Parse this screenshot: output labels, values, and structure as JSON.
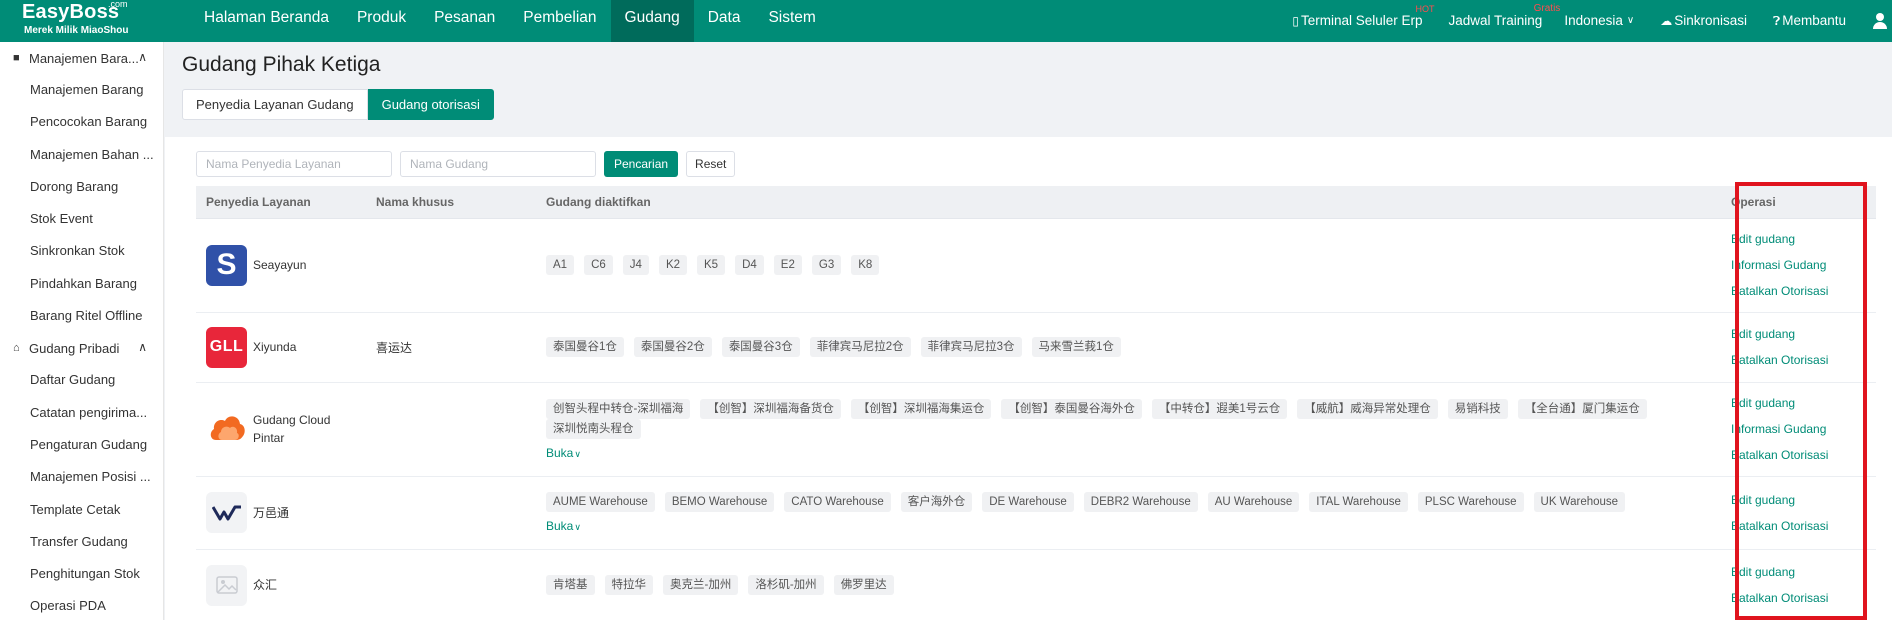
{
  "header": {
    "logo": {
      "brand": "EasyBoss",
      "com": ".com",
      "sub": "Merek Milik MiaoShou"
    },
    "nav": [
      "Halaman Beranda",
      "Produk",
      "Pesanan",
      "Pembelian",
      "Gudang",
      "Data",
      "Sistem"
    ],
    "active_nav": "Gudang",
    "right": {
      "terminal": "Terminal Seluler Erp",
      "terminal_badge": "HOT",
      "training": "Jadwal Training",
      "training_badge": "Gratis",
      "language": "Indonesia",
      "sync": "Sinkronisasi",
      "help": "Membantu"
    }
  },
  "sidebar": {
    "groups": [
      {
        "label": "Manajemen Bara...",
        "icon": "doc-icon",
        "items": [
          "Manajemen Barang",
          "Pencocokan Barang",
          "Manajemen Bahan ...",
          "Dorong Barang",
          "Stok Event",
          "Sinkronkan Stok",
          "Pindahkan Barang",
          "Barang Ritel Offline"
        ]
      },
      {
        "label": "Gudang Pribadi",
        "icon": "home-icon",
        "items": [
          "Daftar Gudang",
          "Catatan pengirima...",
          "Pengaturan Gudang",
          "Manajemen Posisi ...",
          "Template Cetak",
          "Transfer Gudang",
          "Penghitungan Stok",
          "Operasi PDA"
        ]
      }
    ]
  },
  "page": {
    "title": "Gudang Pihak Ketiga",
    "tabs": [
      "Penyedia Layanan Gudang",
      "Gudang otorisasi"
    ],
    "active_tab": "Gudang otorisasi",
    "filters": {
      "provider_placeholder": "Nama Penyedia Layanan",
      "warehouse_placeholder": "Nama Gudang",
      "search_label": "Pencarian",
      "reset_label": "Reset"
    },
    "table": {
      "headers": [
        "Penyedia Layanan",
        "Nama khusus",
        "Gudang diaktifkan",
        "Operasi"
      ],
      "rows": [
        {
          "provider": "Seayayun",
          "logo": "S",
          "custom": "",
          "warehouses": [
            "A1",
            "C6",
            "J4",
            "K2",
            "K5",
            "D4",
            "E2",
            "G3",
            "K8"
          ],
          "more": "",
          "ops": [
            "Edit gudang",
            "Informasi Gudang",
            "Batalkan Otorisasi"
          ]
        },
        {
          "provider": "Xiyunda",
          "logo": "GLL",
          "custom": "喜运达",
          "warehouses": [
            "泰国曼谷1仓",
            "泰国曼谷2仓",
            "泰国曼谷3仓",
            "菲律宾马尼拉2仓",
            "菲律宾马尼拉3仓",
            "马来雪兰莪1仓"
          ],
          "more": "",
          "ops": [
            "Edit gudang",
            "Batalkan Otorisasi"
          ]
        },
        {
          "provider": "Gudang Cloud Pintar",
          "logo": "",
          "custom": "",
          "warehouses": [
            "创智头程中转仓-深圳福海",
            "【创智】深圳福海备货仓",
            "【创智】深圳福海集运仓",
            "【创智】泰国曼谷海外仓",
            "【中转仓】遐美1号云仓",
            "【威航】威海异常处理仓",
            "易销科技",
            "【全台通】厦门集运仓",
            "深圳悦南头程仓"
          ],
          "more": "Buka",
          "ops": [
            "Edit gudang",
            "Informasi Gudang",
            "Batalkan Otorisasi"
          ]
        },
        {
          "provider": "万邑通",
          "logo": "",
          "custom": "",
          "warehouses": [
            "AUME Warehouse",
            "BEMO Warehouse",
            "CATO Warehouse",
            "客户海外仓",
            "DE Warehouse",
            "DEBR2 Warehouse",
            "AU Warehouse",
            "ITAL Warehouse",
            "PLSC Warehouse",
            "UK Warehouse"
          ],
          "more": "Buka",
          "ops": [
            "Edit gudang",
            "Batalkan Otorisasi"
          ]
        },
        {
          "provider": "众汇",
          "logo": "",
          "custom": "",
          "warehouses": [
            "肯塔基",
            "特拉华",
            "奥克兰-加州",
            "洛杉矶-加州",
            "佛罗里达"
          ],
          "more": "",
          "ops": [
            "Edit gudang",
            "Batalkan Otorisasi"
          ]
        }
      ]
    }
  },
  "colors": {
    "primary": "#008c77",
    "nav_active": "#006b5b",
    "highlight": "#e0141e",
    "badge": "#ff4d4f"
  }
}
